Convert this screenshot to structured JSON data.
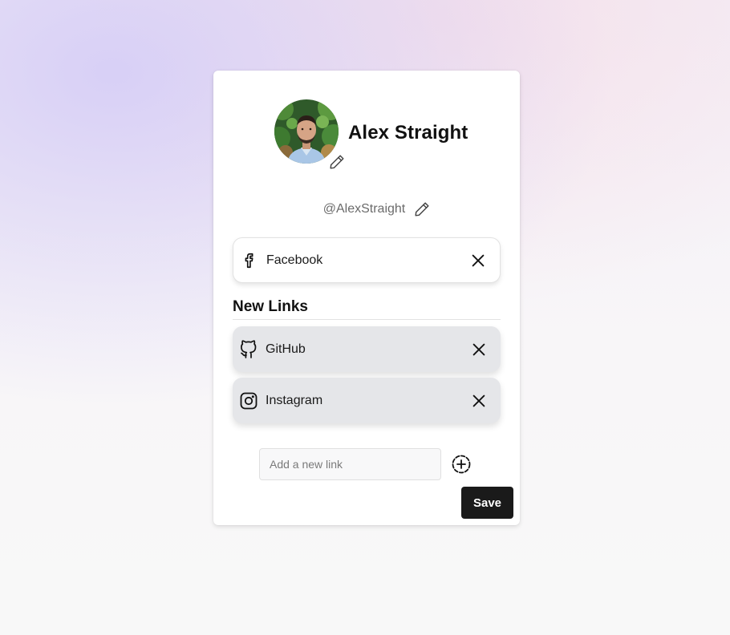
{
  "profile": {
    "name": "Alex Straight",
    "handle": "@AlexStraight",
    "avatar_icon": "profile-photo"
  },
  "existing_links": [
    {
      "label": "Facebook",
      "icon": "facebook-icon"
    }
  ],
  "new_links": {
    "title": "New Links",
    "items": [
      {
        "label": "GitHub",
        "icon": "github-icon"
      },
      {
        "label": "Instagram",
        "icon": "instagram-icon"
      }
    ]
  },
  "add_link": {
    "placeholder": "Add a new link",
    "value": ""
  },
  "actions": {
    "save_label": "Save"
  },
  "colors": {
    "save_bg": "#1a1a1a",
    "new_link_bg": "#e5e6e9",
    "text_primary": "#111111",
    "text_muted": "#6b6b6b"
  }
}
